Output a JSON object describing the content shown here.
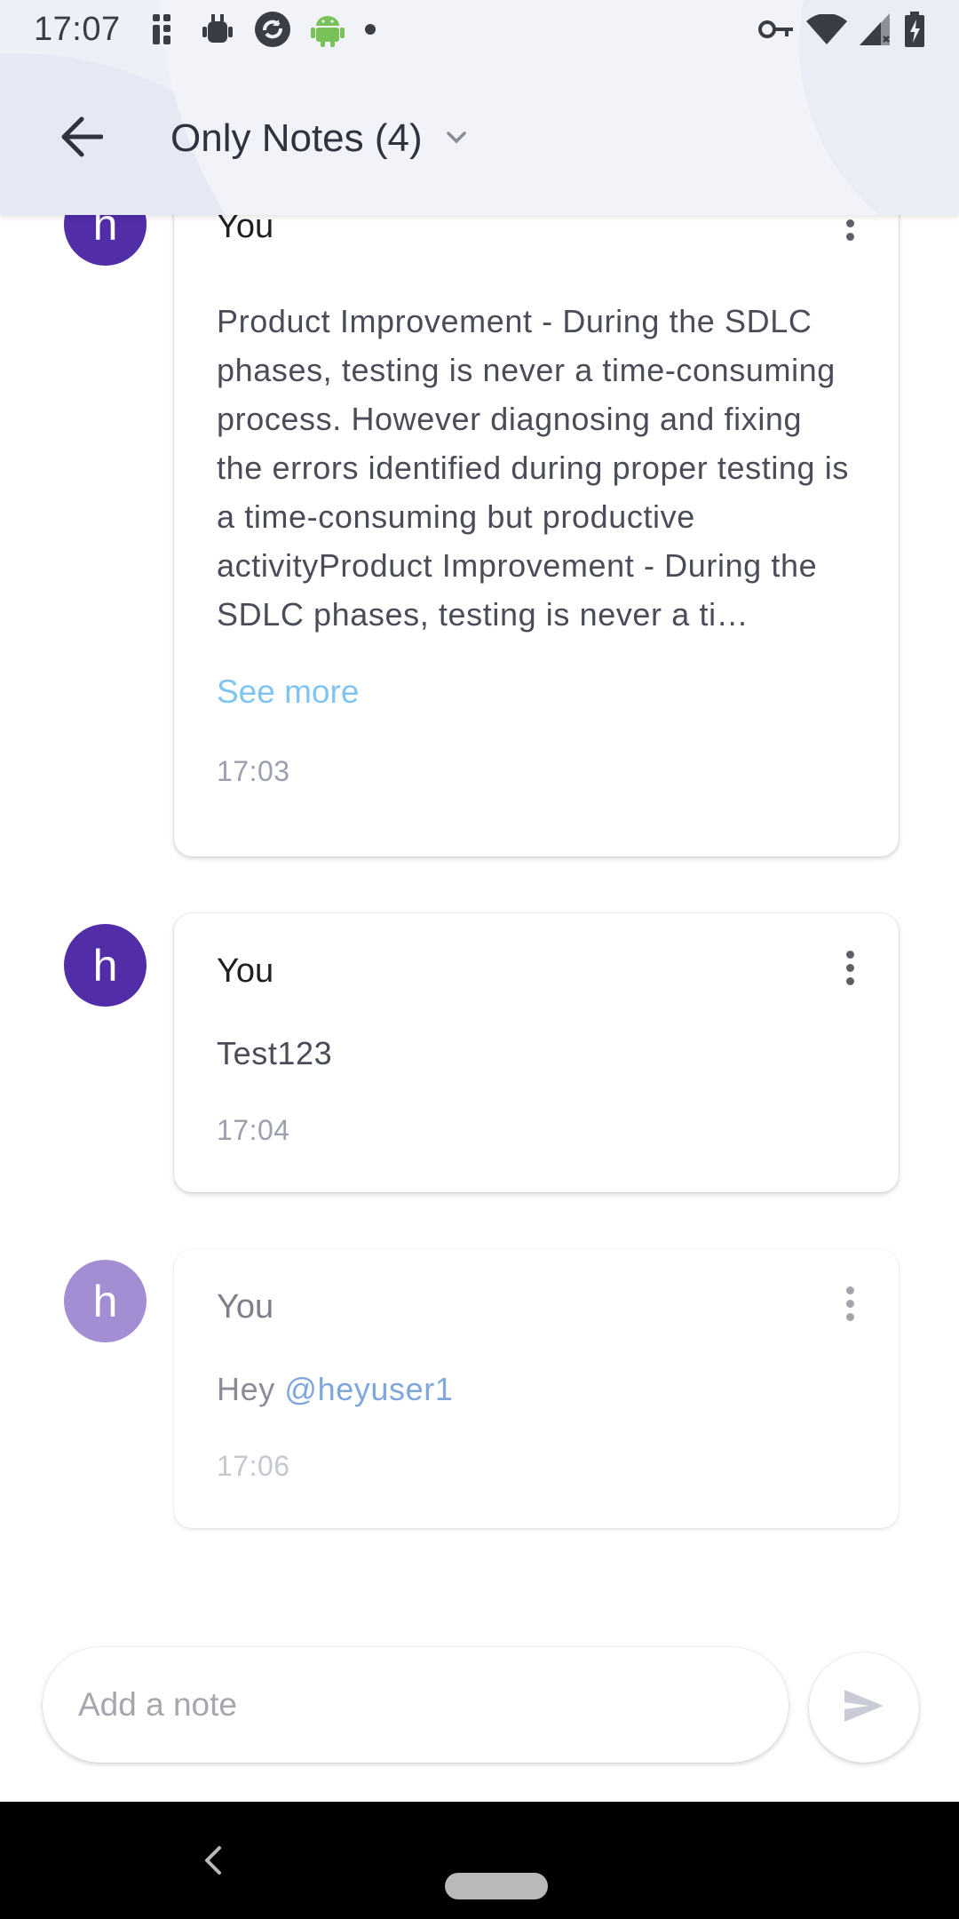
{
  "status_bar": {
    "time": "17:07",
    "left_icons": [
      "fitbit-icon",
      "android-debug-icon",
      "sync-icon",
      "android-icon",
      "dot-icon"
    ],
    "right_icons": [
      "vpn-key-icon",
      "wifi-icon",
      "signal-no-data-icon",
      "battery-charging-icon"
    ]
  },
  "header": {
    "title": "Only Notes (4)",
    "back_icon": "arrow-back-icon",
    "dropdown_icon": "chevron-down-icon"
  },
  "notes": [
    {
      "avatar_letter": "h",
      "author": "You",
      "text": "Product Improvement - During the SDLC phases, testing is never a time-consuming process. However diagnosing and fixing the errors identified during proper testing is a time-consuming but productive activityProduct Improvement - During the SDLC phases, testing is never a ti…",
      "see_more": "See more",
      "time": "17:03"
    },
    {
      "avatar_letter": "h",
      "author": "You",
      "text": "Test123",
      "time": "17:04"
    },
    {
      "avatar_letter": "h",
      "author": "You",
      "text_prefix": "Hey ",
      "mention": "@heyuser1",
      "time": "17:06"
    }
  ],
  "composer": {
    "placeholder": "Add a note",
    "send_icon": "send-icon"
  },
  "colors": {
    "avatar": "#512da8",
    "avatar_faded": "#a38ed3",
    "link": "#82c4f1",
    "header_bg": "#eef0f7"
  }
}
